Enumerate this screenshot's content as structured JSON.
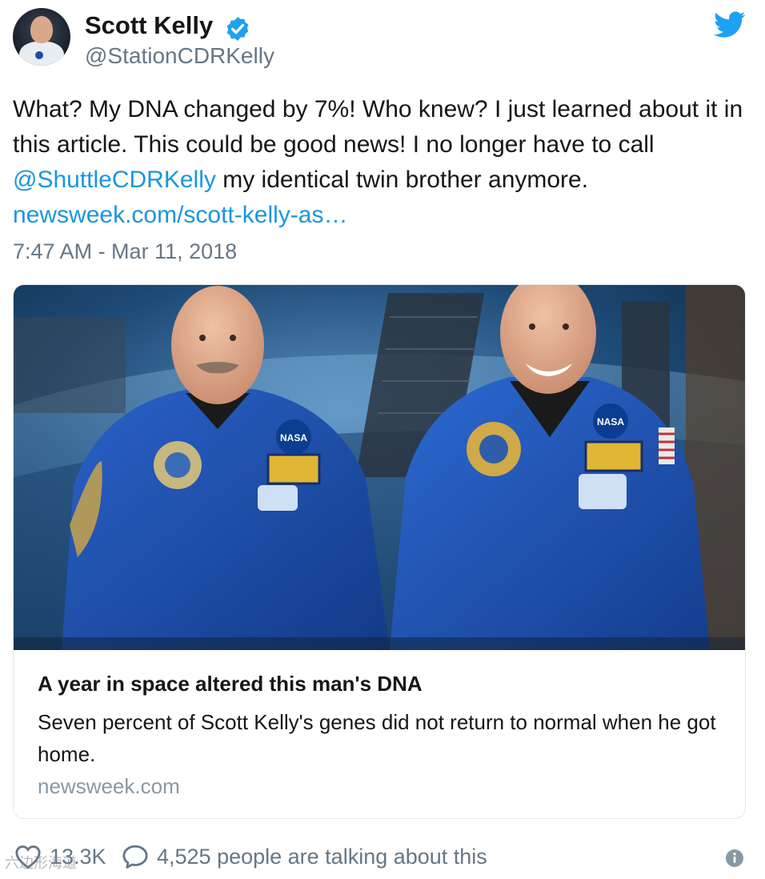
{
  "user": {
    "display_name": "Scott Kelly",
    "handle": "@StationCDRKelly",
    "verified": true
  },
  "tweet": {
    "text_part1": "What? My DNA changed by 7%! Who knew? I just learned about it in this article. This could be good news! I no longer have to call ",
    "mention": "@ShuttleCDRKelly",
    "text_part2": " my identical twin brother anymore.",
    "link": "newsweek.com/scott-kelly-as…",
    "timestamp": "7:47 AM - Mar 11, 2018"
  },
  "card": {
    "title": "A year in space altered this man's DNA",
    "description": "Seven percent of Scott Kelly's genes did not return to normal when he got home.",
    "domain": "newsweek.com",
    "image_patch_text_left": "NASA",
    "image_patch_text_right": "NASA"
  },
  "footer": {
    "likes": "13.3K",
    "talking": "4,525 people are talking about this"
  },
  "watermark": "六边形海道",
  "colors": {
    "link": "#1b95e0",
    "secondary_text": "#657786",
    "twitter_blue": "#1da1f2",
    "suit_blue": "#1f4fb0"
  },
  "icons": [
    "verified-badge-icon",
    "twitter-bird-icon",
    "heart-icon",
    "reply-bubble-icon",
    "info-icon"
  ]
}
